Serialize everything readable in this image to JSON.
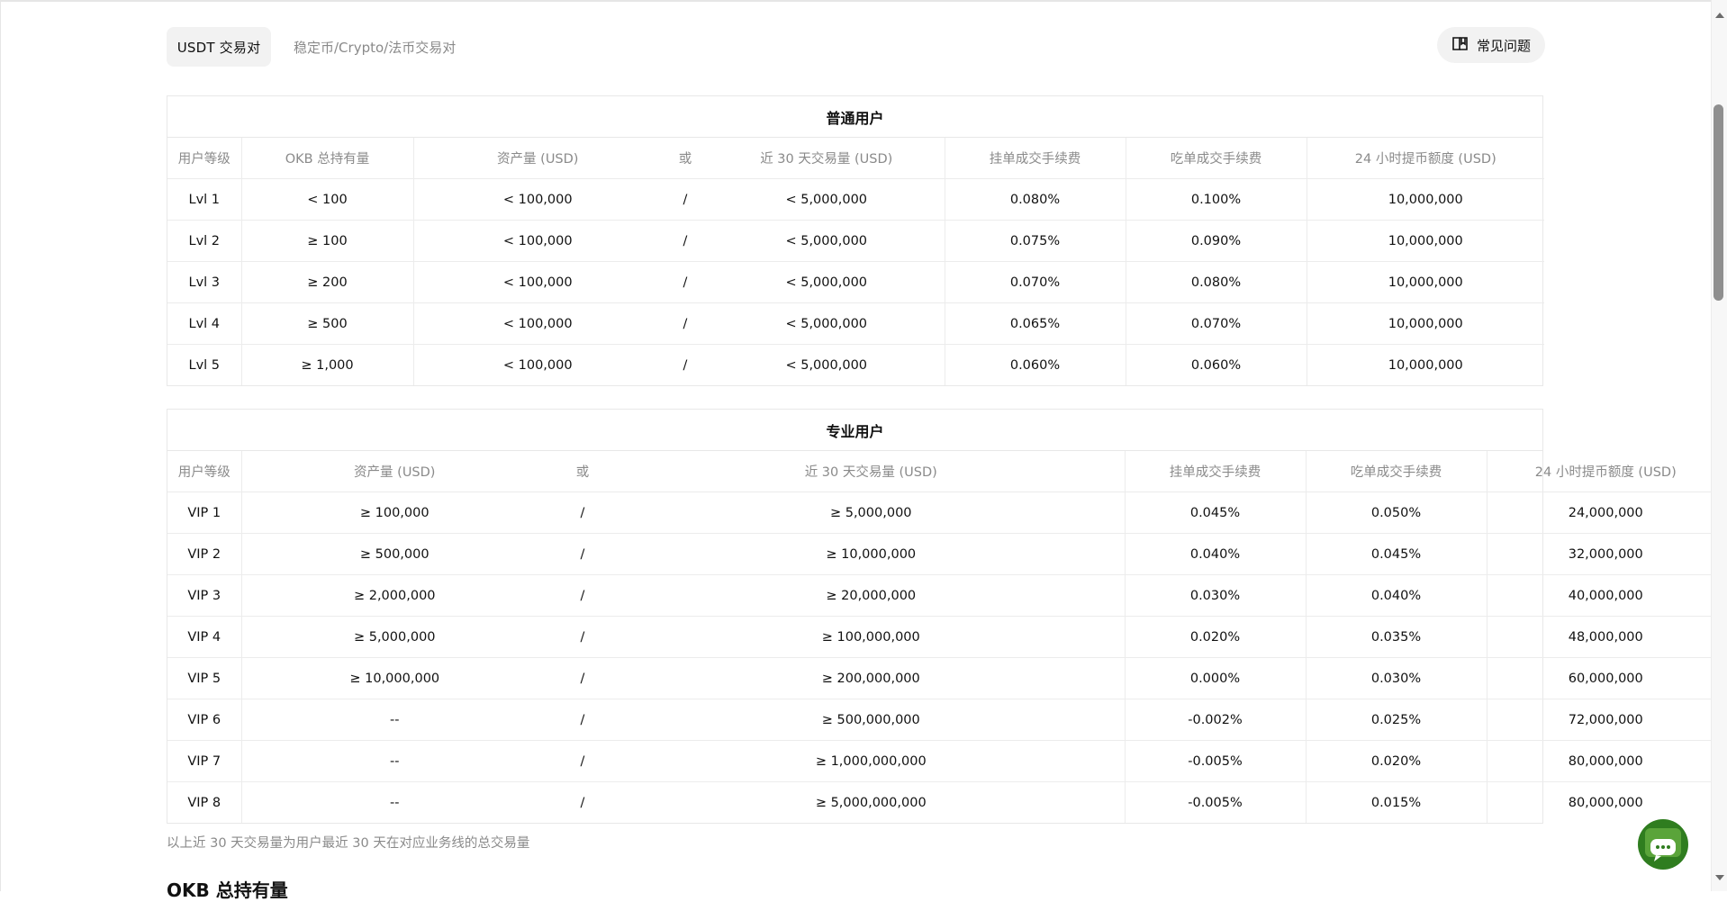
{
  "tabs": {
    "active": "USDT 交易对",
    "inactive": "稳定币/Crypto/法币交易对"
  },
  "faq": {
    "label": "常见问题",
    "icon": "book-icon"
  },
  "regular_table": {
    "title": "普通用户",
    "headers": [
      "用户等级",
      "OKB 总持有量",
      "资产量 (USD)",
      "或",
      "近 30 天交易量 (USD)",
      "挂单成交手续费",
      "吃单成交手续费",
      "24 小时提币额度 (USD)"
    ],
    "rows": [
      [
        "Lvl 1",
        "< 100",
        "< 100,000",
        "/",
        "< 5,000,000",
        "0.080%",
        "0.100%",
        "10,000,000"
      ],
      [
        "Lvl 2",
        "≥ 100",
        "< 100,000",
        "/",
        "< 5,000,000",
        "0.075%",
        "0.090%",
        "10,000,000"
      ],
      [
        "Lvl 3",
        "≥ 200",
        "< 100,000",
        "/",
        "< 5,000,000",
        "0.070%",
        "0.080%",
        "10,000,000"
      ],
      [
        "Lvl 4",
        "≥ 500",
        "< 100,000",
        "/",
        "< 5,000,000",
        "0.065%",
        "0.070%",
        "10,000,000"
      ],
      [
        "Lvl 5",
        "≥ 1,000",
        "< 100,000",
        "/",
        "< 5,000,000",
        "0.060%",
        "0.060%",
        "10,000,000"
      ]
    ]
  },
  "pro_table": {
    "title": "专业用户",
    "headers": [
      "用户等级",
      "资产量 (USD)",
      "或",
      "近 30 天交易量 (USD)",
      "挂单成交手续费",
      "吃单成交手续费",
      "24 小时提币额度 (USD)"
    ],
    "rows": [
      [
        "VIP 1",
        "≥ 100,000",
        "/",
        "≥ 5,000,000",
        "0.045%",
        "0.050%",
        "24,000,000"
      ],
      [
        "VIP 2",
        "≥ 500,000",
        "/",
        "≥ 10,000,000",
        "0.040%",
        "0.045%",
        "32,000,000"
      ],
      [
        "VIP 3",
        "≥ 2,000,000",
        "/",
        "≥ 20,000,000",
        "0.030%",
        "0.040%",
        "40,000,000"
      ],
      [
        "VIP 4",
        "≥ 5,000,000",
        "/",
        "≥ 100,000,000",
        "0.020%",
        "0.035%",
        "48,000,000"
      ],
      [
        "VIP 5",
        "≥ 10,000,000",
        "/",
        "≥ 200,000,000",
        "0.000%",
        "0.030%",
        "60,000,000"
      ],
      [
        "VIP 6",
        "--",
        "/",
        "≥ 500,000,000",
        "-0.002%",
        "0.025%",
        "72,000,000"
      ],
      [
        "VIP 7",
        "--",
        "/",
        "≥ 1,000,000,000",
        "-0.005%",
        "0.020%",
        "80,000,000"
      ],
      [
        "VIP 8",
        "--",
        "/",
        "≥ 5,000,000,000",
        "-0.005%",
        "0.015%",
        "80,000,000"
      ]
    ]
  },
  "footnote": "以上近 30 天交易量为用户最近 30 天在对应业务线的总交易量",
  "next_section_heading": "OKB 总持有量",
  "chat": {
    "icon": "chat-icon"
  },
  "colors": {
    "muted_text": "#8a8a8a",
    "tab_bg": "#f2f2f2",
    "border": "#e8e8e8",
    "chat_bg": "#2f7d1f"
  }
}
